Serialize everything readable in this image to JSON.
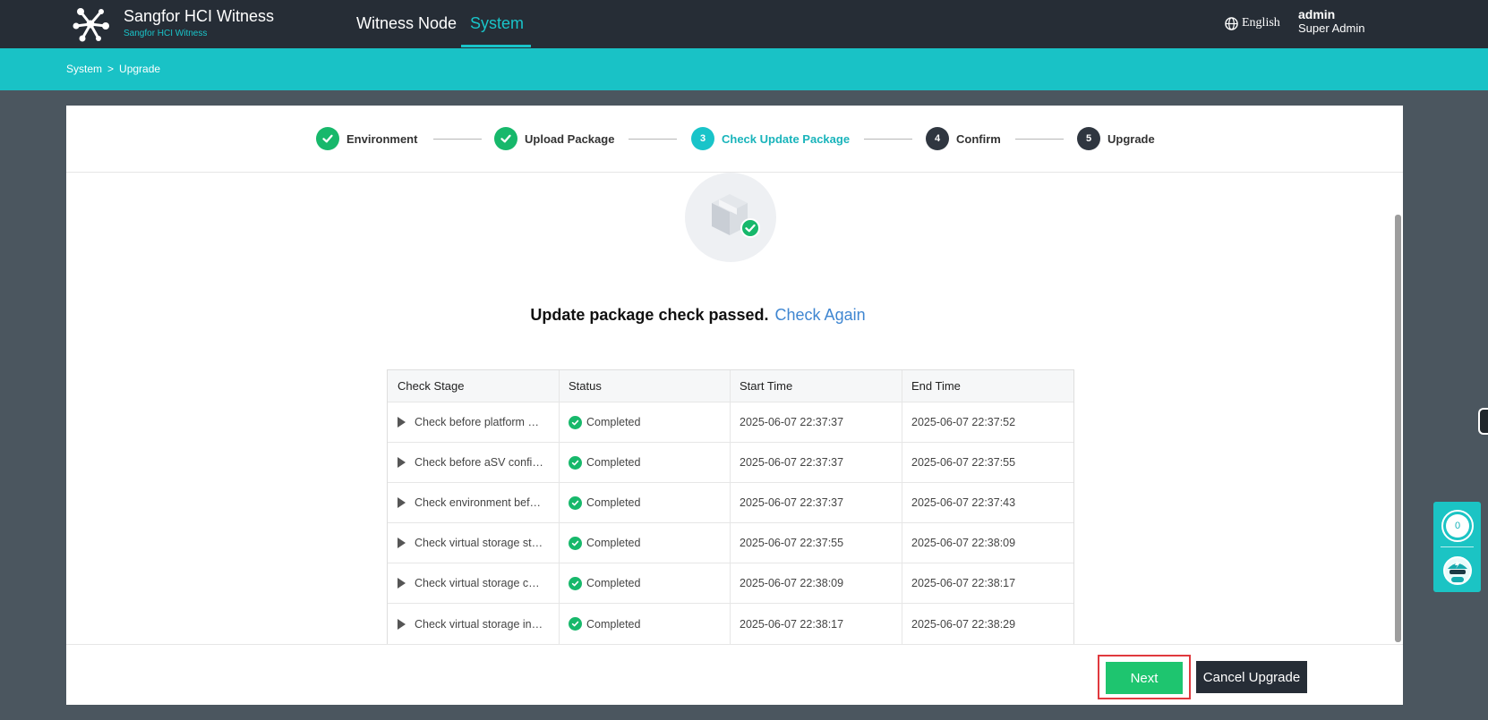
{
  "app": {
    "title": "Sangfor HCI Witness",
    "subtitle": "Sangfor HCI Witness"
  },
  "nav": {
    "items": [
      {
        "label": "Witness Node",
        "active": false
      },
      {
        "label": "System",
        "active": true
      }
    ]
  },
  "header": {
    "language": "English",
    "user_name": "admin",
    "user_role": "Super Admin"
  },
  "breadcrumb": {
    "items": [
      "System",
      "Upgrade"
    ],
    "separator": ">"
  },
  "steps": [
    {
      "label": "Environment",
      "state": "done",
      "number": ""
    },
    {
      "label": "Upload Package",
      "state": "done",
      "number": ""
    },
    {
      "label": "Check Update Package",
      "state": "active",
      "number": "3"
    },
    {
      "label": "Confirm",
      "state": "todo",
      "number": "4"
    },
    {
      "label": "Upgrade",
      "state": "todo",
      "number": "5"
    }
  ],
  "result": {
    "message": "Update package check passed.",
    "link": "Check Again"
  },
  "table": {
    "headers": [
      "Check Stage",
      "Status",
      "Start Time",
      "End Time"
    ],
    "rows": [
      {
        "stage": "Check before platform upgrade",
        "status": "Completed",
        "start": "2025-06-07 22:37:37",
        "end": "2025-06-07 22:37:52"
      },
      {
        "stage": "Check before aSV configuration",
        "status": "Completed",
        "start": "2025-06-07 22:37:37",
        "end": "2025-06-07 22:37:55"
      },
      {
        "stage": "Check environment before upgrade",
        "status": "Completed",
        "start": "2025-06-07 22:37:37",
        "end": "2025-06-07 22:37:43"
      },
      {
        "stage": "Check virtual storage status",
        "status": "Completed",
        "start": "2025-06-07 22:37:55",
        "end": "2025-06-07 22:38:09"
      },
      {
        "stage": "Check virtual storage configuration",
        "status": "Completed",
        "start": "2025-06-07 22:38:09",
        "end": "2025-06-07 22:38:17"
      },
      {
        "stage": "Check virtual storage integrity",
        "status": "Completed",
        "start": "2025-06-07 22:38:17",
        "end": "2025-06-07 22:38:29"
      }
    ]
  },
  "buttons": {
    "next": "Next",
    "cancel": "Cancel Upgrade"
  },
  "widget": {
    "count": "0"
  },
  "colors": {
    "topbar": "#262d36",
    "accent": "#19c4c9",
    "success": "#17b86b",
    "link": "#3f86d1",
    "highlight": "#e0393e"
  },
  "icons": {
    "logo": "network-nodes-icon",
    "language": "globe-icon",
    "step_done": "check-circle-icon",
    "row_expand": "triangle-right-icon",
    "status_ok": "check-circle-icon",
    "package": "package-box-icon"
  }
}
